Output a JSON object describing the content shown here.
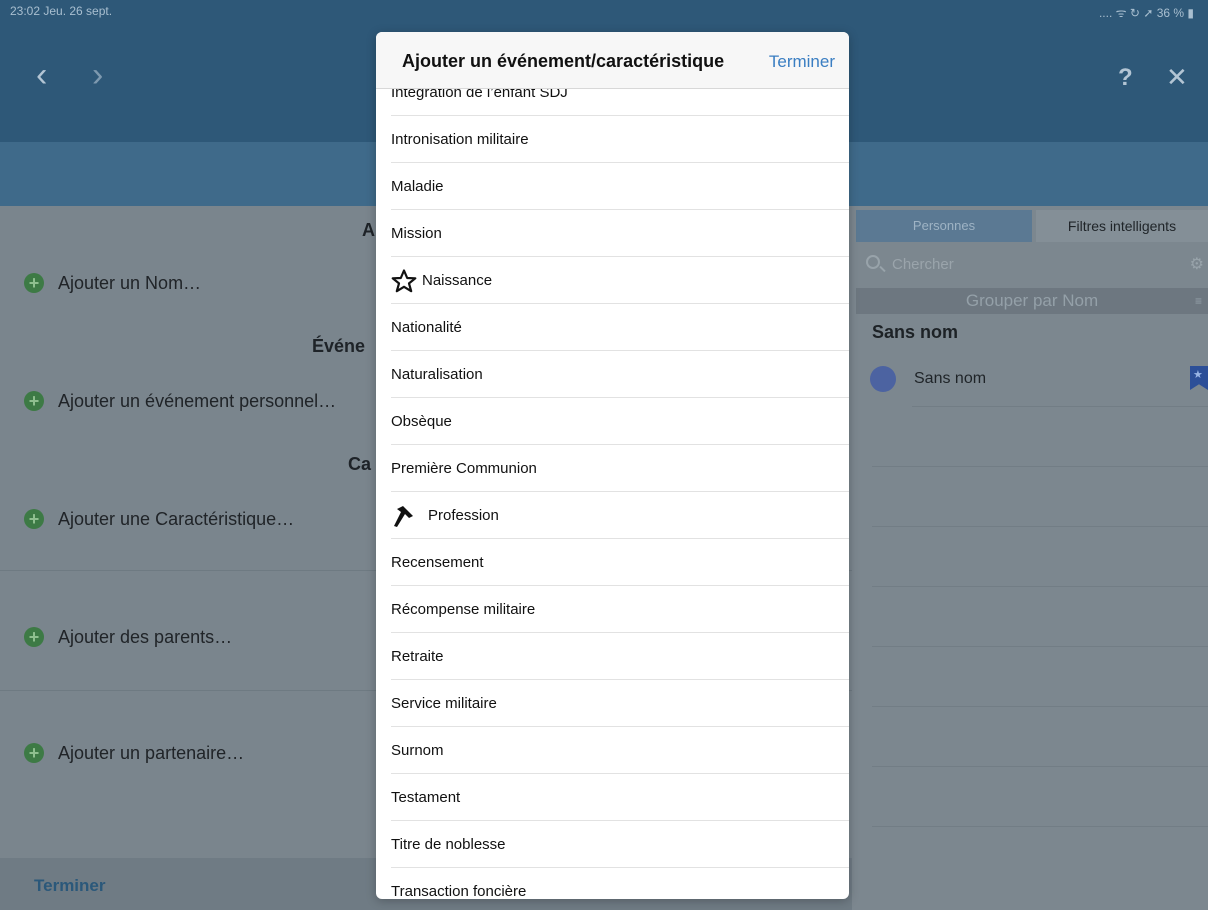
{
  "status_bar": {
    "time_date": "23:02  Jeu. 26 sept.",
    "right": "....  ᯤ ↻ ➚ 36 % ▮"
  },
  "nav": {
    "back_icon": "‹",
    "forward_icon": "›",
    "help_icon": "?",
    "close_icon": "✕"
  },
  "left_pane": {
    "section_names_partial": "A",
    "section_events_partial": "Événe",
    "section_characteristics_partial": "Ca",
    "add_name": "Ajouter un Nom…",
    "add_personal_event": "Ajouter un événement personnel…",
    "add_characteristic": "Ajouter une Caractéristique…",
    "add_parents": "Ajouter des parents…",
    "add_partner": "Ajouter un partenaire…",
    "done_button": "Terminer"
  },
  "right_pane": {
    "tabs": [
      "Personnes",
      "Filtres intelligents"
    ],
    "search_placeholder": "Chercher",
    "group_bar": "Grouper par Nom",
    "group_header": "Sans nom",
    "person_name": "Sans nom"
  },
  "popover": {
    "title": "Ajouter un événement/caractéristique",
    "done_label": "Terminer",
    "items": [
      "Intégration de l’enfant SDJ",
      "Intronisation militaire",
      "Maladie",
      "Mission",
      "Naissance",
      "Nationalité",
      "Naturalisation",
      "Obsèque",
      "Première Communion",
      "Profession",
      "Recensement",
      "Récompense militaire",
      "Retraite",
      "Service militaire",
      "Surnom",
      "Testament",
      "Titre de noblesse",
      "Transaction foncière"
    ]
  }
}
